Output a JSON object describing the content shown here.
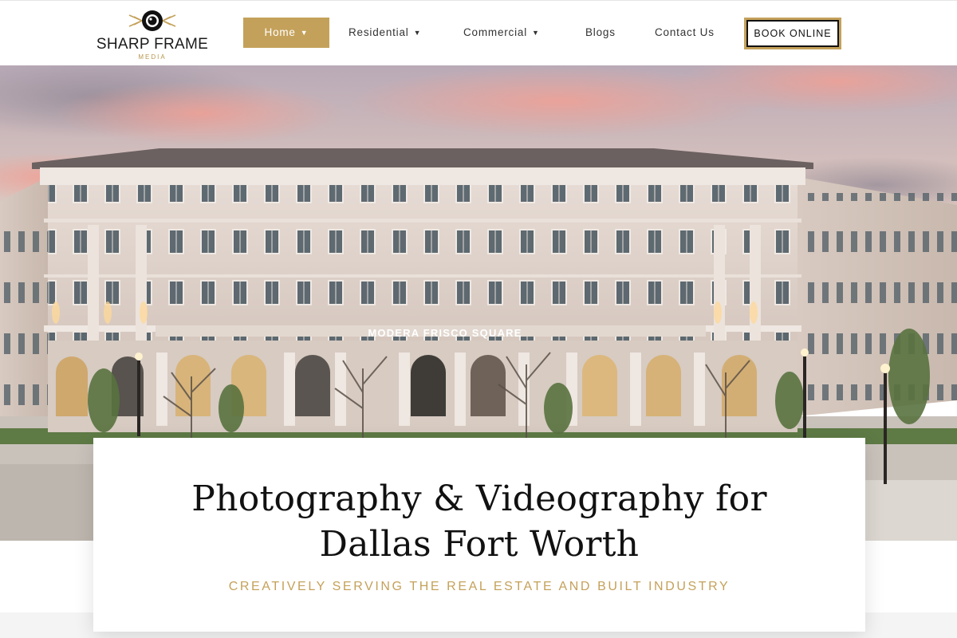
{
  "brand": {
    "name": "SHARP FRAME",
    "sub": "MEDIA",
    "accent": "#c4a15a"
  },
  "nav": {
    "home": "Home",
    "residential": "Residential",
    "commercial": "Commercial",
    "blogs": "Blogs",
    "contact": "Contact Us",
    "chevron": "chevron-down-icon"
  },
  "cta": {
    "book": "BOOK ONLINE"
  },
  "hero": {
    "sign": "MODERA FRISCO SQUARE"
  },
  "card": {
    "title_line1": "Photography & Videography for",
    "title_line2": "Dallas Fort Worth",
    "tagline": "CREATIVELY SERVING THE REAL ESTATE AND BUILT INDUSTRY"
  }
}
